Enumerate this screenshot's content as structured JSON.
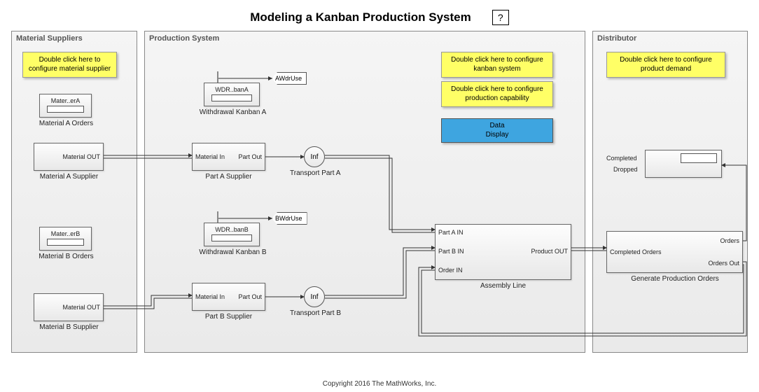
{
  "title": "Modeling a Kanban Production System",
  "help_icon": "?",
  "regions": {
    "suppliers": {
      "label": "Material Suppliers"
    },
    "production": {
      "label": "Production System"
    },
    "distributor": {
      "label": "Distributor"
    }
  },
  "notes": {
    "suppliers_cfg": "Double click here to\nconfigure material supplier",
    "kanban_cfg": "Double click here to configure\nkanban system",
    "production_cfg": "Double click here to configure\nproduction capability",
    "demand_cfg": "Double click here to configure\nproduct demand",
    "data_display": "Data\nDisplay"
  },
  "blocks": {
    "matA_orders": {
      "inner": "Mater..erA",
      "caption": "Material A Orders"
    },
    "matA_supplier": {
      "port": "Material OUT",
      "caption": "Material A Supplier"
    },
    "matB_orders": {
      "inner": "Mater..erB",
      "caption": "Material B Orders"
    },
    "matB_supplier": {
      "port": "Material OUT",
      "caption": "Material B Supplier"
    },
    "wdrA": {
      "inner": "WDR..banA",
      "caption": "Withdrawal Kanban A",
      "tag": "AWdrUse"
    },
    "wdrB": {
      "inner": "WDR..banB",
      "caption": "Withdrawal Kanban B",
      "tag": "BWdrUse"
    },
    "partA_supplier": {
      "in": "Material In",
      "out": "Part Out",
      "caption": "Part A Supplier"
    },
    "partB_supplier": {
      "in": "Material In",
      "out": "Part Out",
      "caption": "Part B Supplier"
    },
    "transportA": {
      "label": "Inf",
      "caption": "Transport Part A"
    },
    "transportB": {
      "label": "Inf",
      "caption": "Transport Part B"
    },
    "assembly": {
      "in1": "Part A IN",
      "in2": "Part B IN",
      "in3": "Order IN",
      "out": "Product OUT",
      "caption": "Assembly Line"
    },
    "display": {
      "l1": "Completed",
      "l2": "Dropped"
    },
    "genorders": {
      "in": "Completed Orders",
      "out1": "Orders",
      "out2": "Orders Out",
      "caption": "Generate Production Orders"
    }
  },
  "footer": "Copyright 2016 The MathWorks, Inc."
}
